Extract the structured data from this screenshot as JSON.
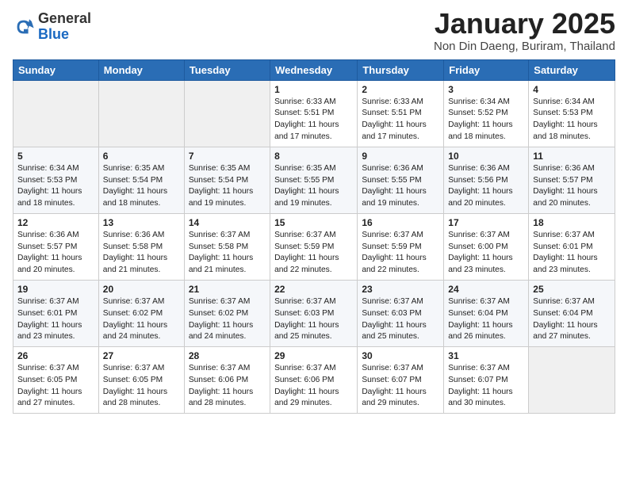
{
  "logo": {
    "general": "General",
    "blue": "Blue"
  },
  "header": {
    "month": "January 2025",
    "location": "Non Din Daeng, Buriram, Thailand"
  },
  "weekdays": [
    "Sunday",
    "Monday",
    "Tuesday",
    "Wednesday",
    "Thursday",
    "Friday",
    "Saturday"
  ],
  "weeks": [
    [
      {
        "day": "",
        "info": ""
      },
      {
        "day": "",
        "info": ""
      },
      {
        "day": "",
        "info": ""
      },
      {
        "day": "1",
        "info": "Sunrise: 6:33 AM\nSunset: 5:51 PM\nDaylight: 11 hours\nand 17 minutes."
      },
      {
        "day": "2",
        "info": "Sunrise: 6:33 AM\nSunset: 5:51 PM\nDaylight: 11 hours\nand 17 minutes."
      },
      {
        "day": "3",
        "info": "Sunrise: 6:34 AM\nSunset: 5:52 PM\nDaylight: 11 hours\nand 18 minutes."
      },
      {
        "day": "4",
        "info": "Sunrise: 6:34 AM\nSunset: 5:53 PM\nDaylight: 11 hours\nand 18 minutes."
      }
    ],
    [
      {
        "day": "5",
        "info": "Sunrise: 6:34 AM\nSunset: 5:53 PM\nDaylight: 11 hours\nand 18 minutes."
      },
      {
        "day": "6",
        "info": "Sunrise: 6:35 AM\nSunset: 5:54 PM\nDaylight: 11 hours\nand 18 minutes."
      },
      {
        "day": "7",
        "info": "Sunrise: 6:35 AM\nSunset: 5:54 PM\nDaylight: 11 hours\nand 19 minutes."
      },
      {
        "day": "8",
        "info": "Sunrise: 6:35 AM\nSunset: 5:55 PM\nDaylight: 11 hours\nand 19 minutes."
      },
      {
        "day": "9",
        "info": "Sunrise: 6:36 AM\nSunset: 5:55 PM\nDaylight: 11 hours\nand 19 minutes."
      },
      {
        "day": "10",
        "info": "Sunrise: 6:36 AM\nSunset: 5:56 PM\nDaylight: 11 hours\nand 20 minutes."
      },
      {
        "day": "11",
        "info": "Sunrise: 6:36 AM\nSunset: 5:57 PM\nDaylight: 11 hours\nand 20 minutes."
      }
    ],
    [
      {
        "day": "12",
        "info": "Sunrise: 6:36 AM\nSunset: 5:57 PM\nDaylight: 11 hours\nand 20 minutes."
      },
      {
        "day": "13",
        "info": "Sunrise: 6:36 AM\nSunset: 5:58 PM\nDaylight: 11 hours\nand 21 minutes."
      },
      {
        "day": "14",
        "info": "Sunrise: 6:37 AM\nSunset: 5:58 PM\nDaylight: 11 hours\nand 21 minutes."
      },
      {
        "day": "15",
        "info": "Sunrise: 6:37 AM\nSunset: 5:59 PM\nDaylight: 11 hours\nand 22 minutes."
      },
      {
        "day": "16",
        "info": "Sunrise: 6:37 AM\nSunset: 5:59 PM\nDaylight: 11 hours\nand 22 minutes."
      },
      {
        "day": "17",
        "info": "Sunrise: 6:37 AM\nSunset: 6:00 PM\nDaylight: 11 hours\nand 23 minutes."
      },
      {
        "day": "18",
        "info": "Sunrise: 6:37 AM\nSunset: 6:01 PM\nDaylight: 11 hours\nand 23 minutes."
      }
    ],
    [
      {
        "day": "19",
        "info": "Sunrise: 6:37 AM\nSunset: 6:01 PM\nDaylight: 11 hours\nand 23 minutes."
      },
      {
        "day": "20",
        "info": "Sunrise: 6:37 AM\nSunset: 6:02 PM\nDaylight: 11 hours\nand 24 minutes."
      },
      {
        "day": "21",
        "info": "Sunrise: 6:37 AM\nSunset: 6:02 PM\nDaylight: 11 hours\nand 24 minutes."
      },
      {
        "day": "22",
        "info": "Sunrise: 6:37 AM\nSunset: 6:03 PM\nDaylight: 11 hours\nand 25 minutes."
      },
      {
        "day": "23",
        "info": "Sunrise: 6:37 AM\nSunset: 6:03 PM\nDaylight: 11 hours\nand 25 minutes."
      },
      {
        "day": "24",
        "info": "Sunrise: 6:37 AM\nSunset: 6:04 PM\nDaylight: 11 hours\nand 26 minutes."
      },
      {
        "day": "25",
        "info": "Sunrise: 6:37 AM\nSunset: 6:04 PM\nDaylight: 11 hours\nand 27 minutes."
      }
    ],
    [
      {
        "day": "26",
        "info": "Sunrise: 6:37 AM\nSunset: 6:05 PM\nDaylight: 11 hours\nand 27 minutes."
      },
      {
        "day": "27",
        "info": "Sunrise: 6:37 AM\nSunset: 6:05 PM\nDaylight: 11 hours\nand 28 minutes."
      },
      {
        "day": "28",
        "info": "Sunrise: 6:37 AM\nSunset: 6:06 PM\nDaylight: 11 hours\nand 28 minutes."
      },
      {
        "day": "29",
        "info": "Sunrise: 6:37 AM\nSunset: 6:06 PM\nDaylight: 11 hours\nand 29 minutes."
      },
      {
        "day": "30",
        "info": "Sunrise: 6:37 AM\nSunset: 6:07 PM\nDaylight: 11 hours\nand 29 minutes."
      },
      {
        "day": "31",
        "info": "Sunrise: 6:37 AM\nSunset: 6:07 PM\nDaylight: 11 hours\nand 30 minutes."
      },
      {
        "day": "",
        "info": ""
      }
    ]
  ]
}
